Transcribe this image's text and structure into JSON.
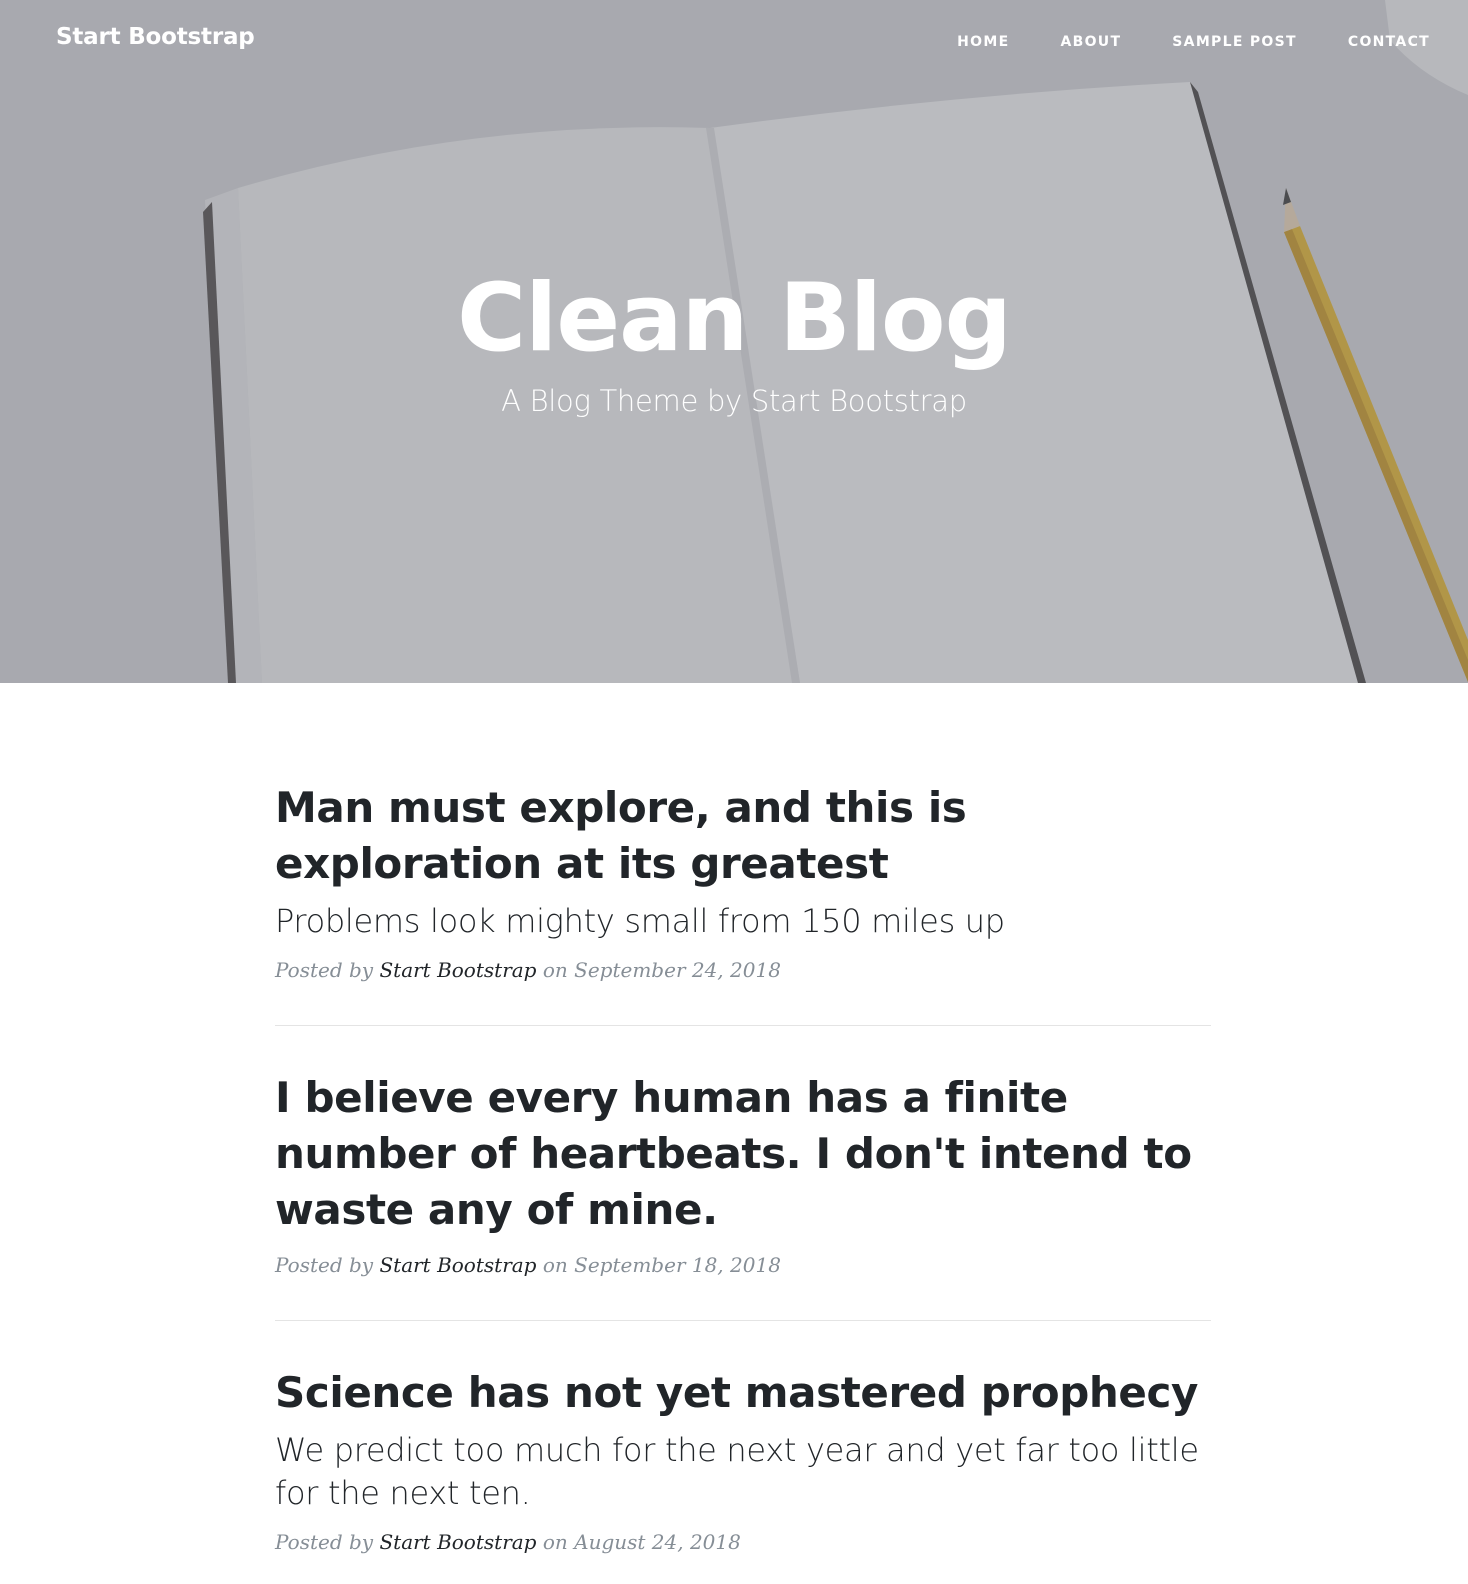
{
  "nav": {
    "brand": "Start Bootstrap",
    "links": [
      {
        "label": "HOME"
      },
      {
        "label": "ABOUT"
      },
      {
        "label": "SAMPLE POST"
      },
      {
        "label": "CONTACT"
      }
    ]
  },
  "hero": {
    "title": "Clean Blog",
    "subtitle": "A Blog Theme by Start Bootstrap"
  },
  "posts": [
    {
      "title": "Man must explore, and this is exploration at its greatest",
      "subtitle": "Problems look mighty small from 150 miles up",
      "meta_prefix": "Posted by ",
      "author": "Start Bootstrap",
      "meta_on": " on ",
      "date": "September 24, 2018"
    },
    {
      "title": "I believe every human has a finite number of heartbeats. I don't intend to waste any of mine.",
      "subtitle": "",
      "meta_prefix": "Posted by ",
      "author": "Start Bootstrap",
      "meta_on": " on ",
      "date": "September 18, 2018"
    },
    {
      "title": "Science has not yet mastered prophecy",
      "subtitle": "We predict too much for the next year and yet far too little for the next ten.",
      "meta_prefix": "Posted by ",
      "author": "Start Bootstrap",
      "meta_on": " on ",
      "date": "August 24, 2018"
    }
  ],
  "colors": {
    "text": "#212529",
    "meta": "#868e96",
    "hero_overlay": "#6e7078",
    "pencil": "#e2b227"
  }
}
